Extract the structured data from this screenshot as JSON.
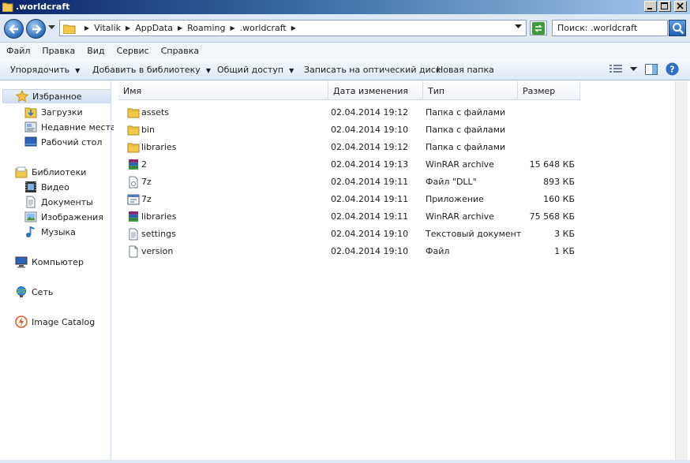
{
  "window": {
    "title": ".worldcraft"
  },
  "address": {
    "crumbs": [
      "Vitalik",
      "AppData",
      "Roaming",
      ".worldcraft"
    ],
    "search_placeholder": "Поиск: .worldcraft"
  },
  "menu": [
    "Файл",
    "Правка",
    "Вид",
    "Сервис",
    "Справка"
  ],
  "commands": {
    "organize": "Упорядочить",
    "add_library": "Добавить в библиотеку",
    "share": "Общий доступ",
    "burn": "Записать на оптический диск",
    "new_folder": "Новая папка"
  },
  "nav": {
    "favorites": "Избранное",
    "downloads": "Загрузки",
    "recent": "Недавние места",
    "desktop": "Рабочий стол",
    "libraries": "Библиотеки",
    "video": "Видео",
    "documents": "Документы",
    "images": "Изображения",
    "music": "Музыка",
    "computer": "Компьютер",
    "network": "Сеть",
    "image_catalog": "Image Catalog"
  },
  "columns": {
    "name": "Имя",
    "date": "Дата изменения",
    "type": "Тип",
    "size": "Размер"
  },
  "files": [
    {
      "name": "assets",
      "date": "02.04.2014 19:12",
      "type": "Папка с файлами",
      "size": "",
      "icon": "folder-icon"
    },
    {
      "name": "bin",
      "date": "02.04.2014 19:10",
      "type": "Папка с файлами",
      "size": "",
      "icon": "folder-icon"
    },
    {
      "name": "libraries",
      "date": "02.04.2014 19:12",
      "type": "Папка с файлами",
      "size": "",
      "icon": "folder-icon"
    },
    {
      "name": "2",
      "date": "02.04.2014 19:13",
      "type": "WinRAR archive",
      "size": "15 648 КБ",
      "icon": "winrar-icon"
    },
    {
      "name": "7z",
      "date": "02.04.2014 19:11",
      "type": "Файл \"DLL\"",
      "size": "893 КБ",
      "icon": "dll-file-icon"
    },
    {
      "name": "7z",
      "date": "02.04.2014 19:11",
      "type": "Приложение",
      "size": "160 КБ",
      "icon": "application-icon"
    },
    {
      "name": "libraries",
      "date": "02.04.2014 19:11",
      "type": "WinRAR archive",
      "size": "75 568 КБ",
      "icon": "winrar-icon"
    },
    {
      "name": "settings",
      "date": "02.04.2014 19:10",
      "type": "Текстовый документ",
      "size": "3 КБ",
      "icon": "text-file-icon"
    },
    {
      "name": "version",
      "date": "02.04.2014 19:10",
      "type": "Файл",
      "size": "1 КБ",
      "icon": "blank-file-icon"
    }
  ]
}
